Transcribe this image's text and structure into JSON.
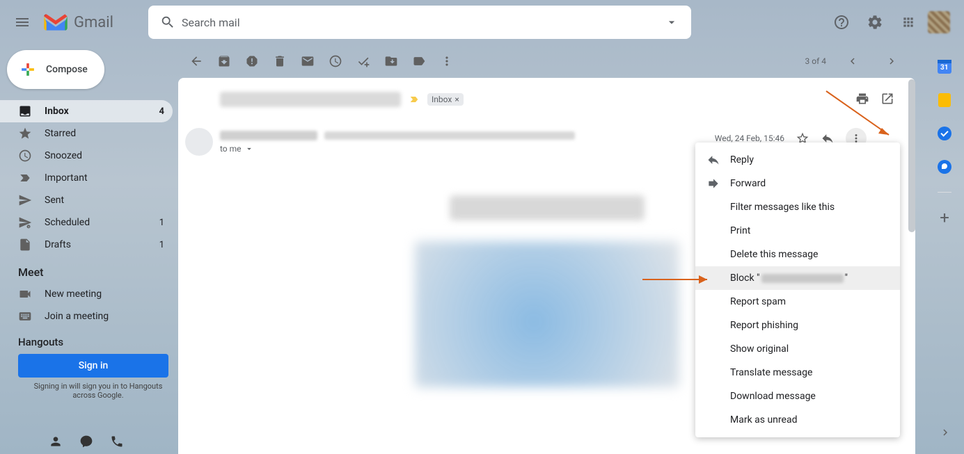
{
  "header": {
    "app_name": "Gmail",
    "search_placeholder": "Search mail"
  },
  "compose_label": "Compose",
  "sidebar": {
    "items": [
      {
        "label": "Inbox",
        "count": "4"
      },
      {
        "label": "Starred",
        "count": ""
      },
      {
        "label": "Snoozed",
        "count": ""
      },
      {
        "label": "Important",
        "count": ""
      },
      {
        "label": "Sent",
        "count": ""
      },
      {
        "label": "Scheduled",
        "count": "1"
      },
      {
        "label": "Drafts",
        "count": "1"
      }
    ],
    "meet_heading": "Meet",
    "meet_items": [
      {
        "label": "New meeting"
      },
      {
        "label": "Join a meeting"
      }
    ],
    "hangouts_heading": "Hangouts",
    "signin_label": "Sign in",
    "signin_note": "Signing in will sign you in to Hangouts across Google."
  },
  "toolbar": {
    "counter": "3 of 4"
  },
  "message": {
    "inbox_chip": "Inbox",
    "to_line": "to me",
    "date": "Wed, 24 Feb, 15:46"
  },
  "context_menu": {
    "reply": "Reply",
    "forward": "Forward",
    "filter": "Filter messages like this",
    "print": "Print",
    "delete": "Delete this message",
    "block_prefix": "Block \"",
    "block_suffix": "\"",
    "report_spam": "Report spam",
    "report_phishing": "Report phishing",
    "show_original": "Show original",
    "translate": "Translate message",
    "download": "Download message",
    "mark_unread": "Mark as unread"
  },
  "rail": {
    "calendar_day": "31"
  }
}
